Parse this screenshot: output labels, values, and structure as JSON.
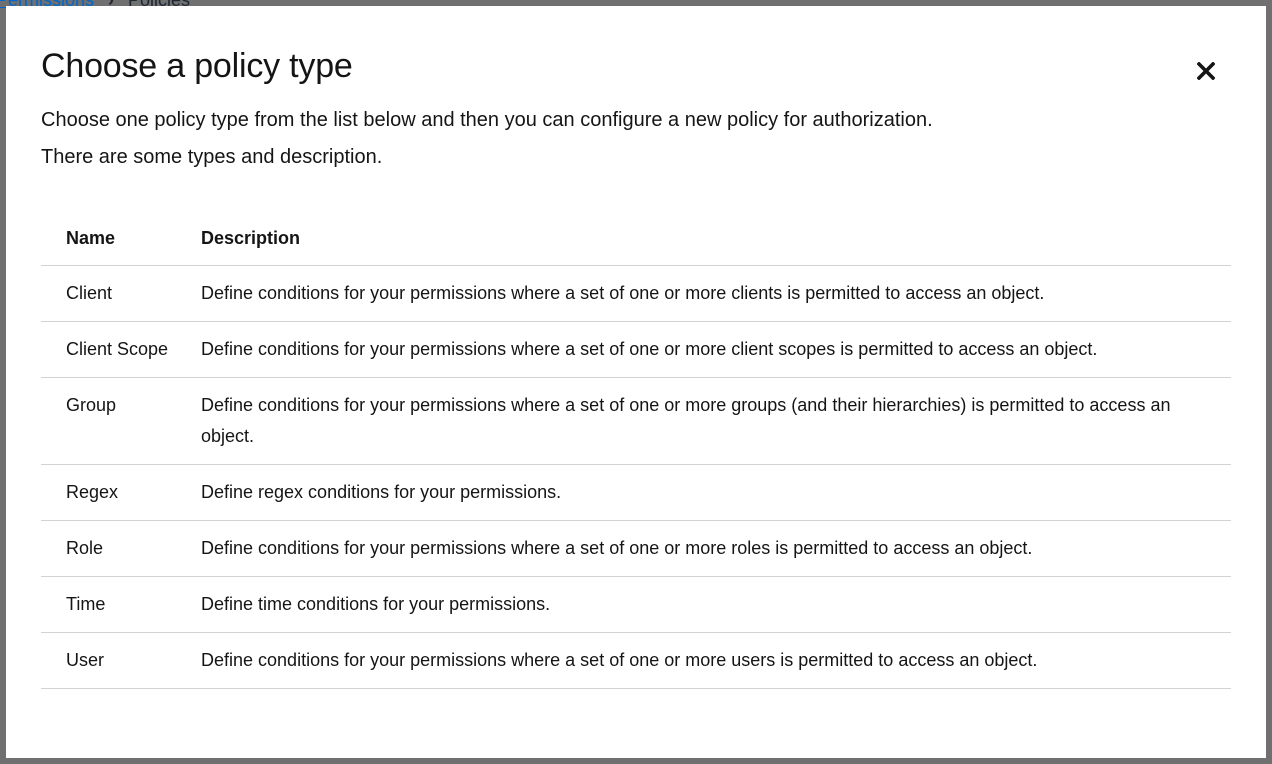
{
  "background": {
    "breadcrumb_link": "Permissions",
    "breadcrumb_separator": "›",
    "breadcrumb_current": "Policies"
  },
  "modal": {
    "title": "Choose a policy type",
    "close_icon": "close-icon",
    "description_line1": "Choose one policy type from the list below and then you can configure a new policy for authorization.",
    "description_line2": "There are some types and description."
  },
  "table": {
    "headers": {
      "name": "Name",
      "description": "Description"
    },
    "rows": [
      {
        "name": "Client",
        "description": "Define conditions for your permissions where a set of one or more clients is permitted to access an object."
      },
      {
        "name": "Client Scope",
        "description": "Define conditions for your permissions where a set of one or more client scopes is permitted to access an object."
      },
      {
        "name": "Group",
        "description": "Define conditions for your permissions where a set of one or more groups (and their hierarchies) is permitted to access an object."
      },
      {
        "name": "Regex",
        "description": "Define regex conditions for your permissions."
      },
      {
        "name": "Role",
        "description": "Define conditions for your permissions where a set of one or more roles is permitted to access an object."
      },
      {
        "name": "Time",
        "description": "Define time conditions for your permissions."
      },
      {
        "name": "User",
        "description": "Define conditions for your permissions where a set of one or more users is permitted to access an object."
      }
    ]
  }
}
